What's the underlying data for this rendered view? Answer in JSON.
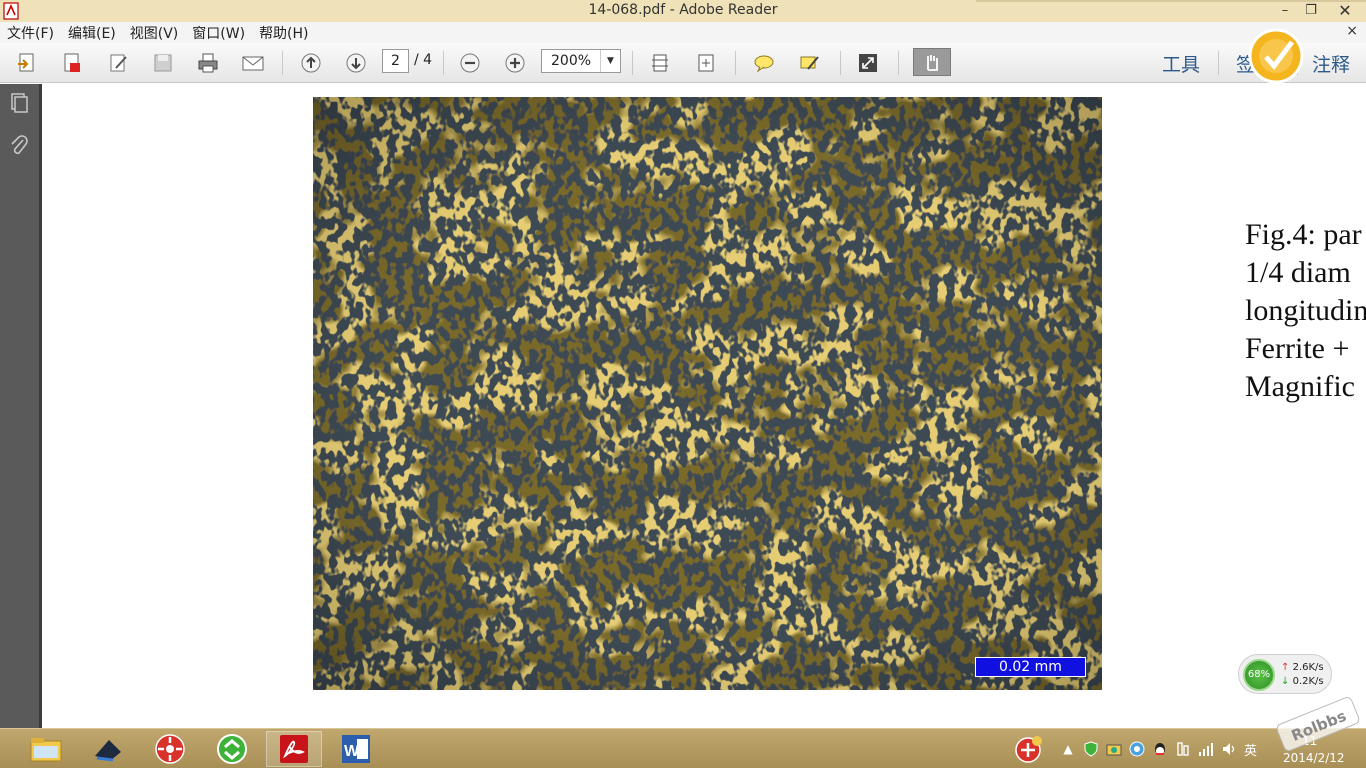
{
  "window": {
    "title": "14-068.pdf - Adobe Reader",
    "minimize_glyph": "–",
    "restore_glyph": "❐",
    "close_glyph": "✕"
  },
  "menu": {
    "items": [
      "文件(F)",
      "编辑(E)",
      "视图(V)",
      "窗口(W)",
      "帮助(H)"
    ],
    "close_glyph": "×"
  },
  "toolbar": {
    "page_current": "2",
    "page_total": "/ 4",
    "zoom": "200%",
    "tools_label": "工具",
    "sign_label": "签",
    "comment_label": "注释",
    "icons": [
      "create-pdf-icon",
      "export-pdf-icon",
      "edit-icon",
      "save-icon",
      "print-icon",
      "email-icon",
      "page-up-icon",
      "page-down-icon",
      "zoom-out-icon",
      "zoom-in-icon",
      "fit-page-icon",
      "fit-width-icon",
      "comment-icon",
      "highlight-icon",
      "fullscreen-icon",
      "hand-tool-icon"
    ]
  },
  "document": {
    "scale_bar": "0.02 mm",
    "caption_lines": [
      "Fig.4: par",
      "1/4  diam",
      "longitudin",
      "Ferrite + ",
      "Magnific"
    ]
  },
  "net_widget": {
    "percent": "68%",
    "up_speed": "2.6K/s",
    "down_speed": "0.2K/s",
    "up_arrow": "↑",
    "down_arrow": "↓"
  },
  "taskbar": {
    "apps": [
      "file-explorer-icon",
      "media-app-icon",
      "launcher-app-icon",
      "sync-app-icon",
      "adobe-reader-icon",
      "word-icon"
    ],
    "ime": "英",
    "time": "11",
    "date": "2014/2/12",
    "watermark": "Rolbbs",
    "accent": "#b09860"
  }
}
